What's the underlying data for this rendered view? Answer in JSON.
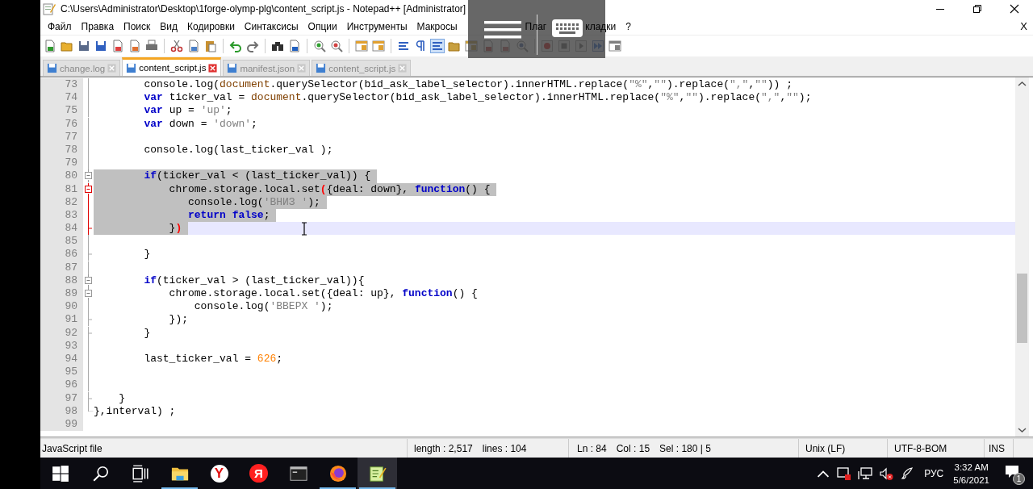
{
  "window": {
    "title": "C:\\Users\\Administrator\\Desktop\\1forge-olymp-plg\\content_script.js - Notepad++ [Administrator]",
    "close_document": "X"
  },
  "menu": [
    "Файл",
    "Правка",
    "Поиск",
    "Вид",
    "Кодировки",
    "Синтаксисы",
    "Опции",
    "Инструменты",
    "Макросы",
    "Плаг",
    "кладки",
    "?"
  ],
  "tabs": [
    {
      "label": "change.log",
      "selected": false
    },
    {
      "label": "content_script.js",
      "selected": true
    },
    {
      "label": "manifest.json",
      "selected": false
    },
    {
      "label": "content_script.js",
      "selected": false
    }
  ],
  "editor": {
    "lines": [
      {
        "number": "73",
        "kind": "line",
        "active": false,
        "selected": false,
        "current": false,
        "segments": [
          {
            "kind": "plain",
            "text": "        console.log("
          },
          {
            "kind": "object",
            "text": "document"
          },
          {
            "kind": "plain",
            "text": ".querySelector(bid_ask_label_selector).innerHTML.replace("
          },
          {
            "kind": "string",
            "text": "\"%\""
          },
          {
            "kind": "plain",
            "text": ","
          },
          {
            "kind": "string",
            "text": "\"\""
          },
          {
            "kind": "plain",
            "text": ").replace("
          },
          {
            "kind": "string",
            "text": "\",\""
          },
          {
            "kind": "plain",
            "text": ","
          },
          {
            "kind": "string",
            "text": "\"\""
          },
          {
            "kind": "plain",
            "text": ")) ;"
          }
        ]
      },
      {
        "number": "74",
        "kind": "line",
        "active": false,
        "selected": false,
        "current": false,
        "segments": [
          {
            "kind": "keyword",
            "text": "        var"
          },
          {
            "kind": "plain",
            "text": " ticker_val = "
          },
          {
            "kind": "object",
            "text": "document"
          },
          {
            "kind": "plain",
            "text": ".querySelector(bid_ask_label_selector).innerHTML.replace("
          },
          {
            "kind": "string",
            "text": "\"%\""
          },
          {
            "kind": "plain",
            "text": ","
          },
          {
            "kind": "string",
            "text": "\"\""
          },
          {
            "kind": "plain",
            "text": ").replace("
          },
          {
            "kind": "string",
            "text": "\",\""
          },
          {
            "kind": "plain",
            "text": ","
          },
          {
            "kind": "string",
            "text": "\"\""
          },
          {
            "kind": "plain",
            "text": ");"
          }
        ]
      },
      {
        "number": "75",
        "kind": "line",
        "active": false,
        "selected": false,
        "current": false,
        "segments": [
          {
            "kind": "keyword",
            "text": "        var"
          },
          {
            "kind": "plain",
            "text": " up = "
          },
          {
            "kind": "string",
            "text": "'up'"
          },
          {
            "kind": "plain",
            "text": ";"
          }
        ]
      },
      {
        "number": "76",
        "kind": "line",
        "active": false,
        "selected": false,
        "current": false,
        "segments": [
          {
            "kind": "keyword",
            "text": "        var"
          },
          {
            "kind": "plain",
            "text": " down = "
          },
          {
            "kind": "string",
            "text": "'down'"
          },
          {
            "kind": "plain",
            "text": ";"
          }
        ]
      },
      {
        "number": "77",
        "kind": "line",
        "active": false,
        "selected": false,
        "current": false
      },
      {
        "number": "78",
        "kind": "line",
        "active": false,
        "selected": false,
        "current": false,
        "segments": [
          {
            "kind": "plain",
            "text": "        console.log(last_ticker_val );"
          }
        ]
      },
      {
        "number": "79",
        "kind": "line",
        "active": false,
        "selected": false,
        "current": false
      },
      {
        "number": "80",
        "kind": "open",
        "active": false,
        "selected": true,
        "current": false,
        "segments": [
          {
            "kind": "keyword",
            "text": "        if"
          },
          {
            "kind": "plain",
            "text": "(ticker_val < (last_ticker_val)) {"
          }
        ]
      },
      {
        "number": "81",
        "kind": "open",
        "active": true,
        "selected": true,
        "current": false,
        "segments": [
          {
            "kind": "plain",
            "text": "            chrome.storage.local.set"
          },
          {
            "kind": "brace_match",
            "text": "("
          },
          {
            "kind": "plain",
            "text": "{deal: down}, "
          },
          {
            "kind": "keyword",
            "text": "function"
          },
          {
            "kind": "plain",
            "text": "() {"
          }
        ]
      },
      {
        "number": "82",
        "kind": "line",
        "active": true,
        "selected": true,
        "current": false,
        "segments": [
          {
            "kind": "plain",
            "text": "               console.log("
          },
          {
            "kind": "string",
            "text": "'ВНИЗ '"
          },
          {
            "kind": "plain",
            "text": ");"
          }
        ]
      },
      {
        "number": "83",
        "kind": "line",
        "active": true,
        "selected": true,
        "current": false,
        "segments": [
          {
            "kind": "keyword",
            "text": "               return false"
          },
          {
            "kind": "plain",
            "text": ";"
          }
        ]
      },
      {
        "number": "84",
        "kind": "end",
        "active": true,
        "selected": true,
        "current": true,
        "segments": [
          {
            "kind": "plain",
            "text": "            }"
          },
          {
            "kind": "brace_match",
            "text": ")"
          }
        ]
      },
      {
        "number": "85",
        "kind": "line",
        "active": false,
        "selected": false,
        "current": false
      },
      {
        "number": "86",
        "kind": "end",
        "active": false,
        "selected": false,
        "current": false,
        "segments": [
          {
            "kind": "plain",
            "text": "        }"
          }
        ]
      },
      {
        "number": "87",
        "kind": "line",
        "active": false,
        "selected": false,
        "current": false
      },
      {
        "number": "88",
        "kind": "open",
        "active": false,
        "selected": false,
        "current": false,
        "segments": [
          {
            "kind": "keyword",
            "text": "        if"
          },
          {
            "kind": "plain",
            "text": "(ticker_val > (last_ticker_val)){"
          }
        ]
      },
      {
        "number": "89",
        "kind": "open",
        "active": false,
        "selected": false,
        "current": false,
        "segments": [
          {
            "kind": "plain",
            "text": "            chrome.storage.local.set({deal: up}, "
          },
          {
            "kind": "keyword",
            "text": "function"
          },
          {
            "kind": "plain",
            "text": "() {"
          }
        ]
      },
      {
        "number": "90",
        "kind": "line",
        "active": false,
        "selected": false,
        "current": false,
        "segments": [
          {
            "kind": "plain",
            "text": "                console.log("
          },
          {
            "kind": "string",
            "text": "'ВВЕРХ '"
          },
          {
            "kind": "plain",
            "text": ");"
          }
        ]
      },
      {
        "number": "91",
        "kind": "end",
        "active": false,
        "selected": false,
        "current": false,
        "segments": [
          {
            "kind": "plain",
            "text": "            });"
          }
        ]
      },
      {
        "number": "92",
        "kind": "end",
        "active": false,
        "selected": false,
        "current": false,
        "segments": [
          {
            "kind": "plain",
            "text": "        }"
          }
        ]
      },
      {
        "number": "93",
        "kind": "line",
        "active": false,
        "selected": false,
        "current": false
      },
      {
        "number": "94",
        "kind": "line",
        "active": false,
        "selected": false,
        "current": false,
        "segments": [
          {
            "kind": "plain",
            "text": "        last_ticker_val = "
          },
          {
            "kind": "number",
            "text": "626"
          },
          {
            "kind": "plain",
            "text": ";"
          }
        ]
      },
      {
        "number": "95",
        "kind": "line",
        "active": false,
        "selected": false,
        "current": false
      },
      {
        "number": "96",
        "kind": "line",
        "active": false,
        "selected": false,
        "current": false
      },
      {
        "number": "97",
        "kind": "end",
        "active": false,
        "selected": false,
        "current": false,
        "segments": [
          {
            "kind": "plain",
            "text": "    }"
          }
        ]
      },
      {
        "number": "98",
        "kind": "last",
        "active": false,
        "selected": false,
        "current": false,
        "segments": [
          {
            "kind": "plain",
            "text": "},interval) ;"
          }
        ]
      },
      {
        "number": "99",
        "kind": "none",
        "selected": false,
        "current": false
      }
    ]
  },
  "status_bar": {
    "file_type": "JavaScript file",
    "length": "length : 2,517",
    "lines": "lines : 104",
    "ln": "Ln : 84",
    "col": "Col : 15",
    "sel": "Sel : 180 | 5",
    "eol": "Unix (LF)",
    "encoding": "UTF-8-BOM",
    "mode": "INS"
  },
  "taskbar": {
    "apps": [
      {
        "kind": "explorer",
        "running": true,
        "selected": false
      },
      {
        "kind": "yandex-browser",
        "letter": "Y",
        "running": false,
        "selected": false
      },
      {
        "kind": "yandex",
        "letter": "Я",
        "running": false,
        "selected": false
      },
      {
        "kind": "terminal",
        "running": false,
        "selected": false
      },
      {
        "kind": "firefox",
        "running": true,
        "selected": false
      },
      {
        "kind": "notepad",
        "running": true,
        "selected": true
      }
    ],
    "language": "РУС",
    "time": "3:32 AM",
    "date": "5/6/2021",
    "notifications": "1"
  }
}
